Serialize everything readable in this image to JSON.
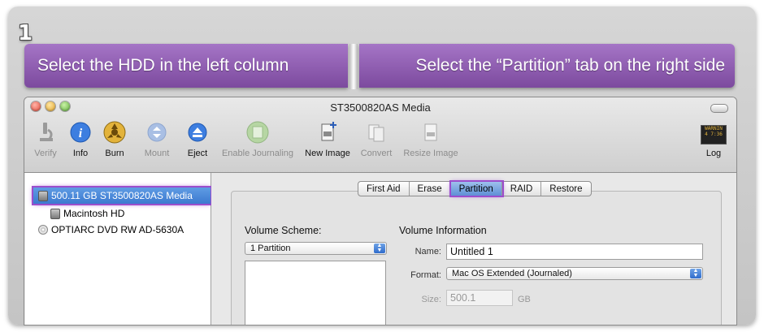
{
  "step_number": "1",
  "instructions": {
    "left": "Select the HDD in the left column",
    "right": "Select the “Partition” tab on the right side"
  },
  "window": {
    "title": "ST3500820AS Media"
  },
  "toolbar": {
    "verify": "Verify",
    "info": "Info",
    "burn": "Burn",
    "mount": "Mount",
    "eject": "Eject",
    "enable_journaling": "Enable Journaling",
    "new_image": "New Image",
    "convert": "Convert",
    "resize_image": "Resize Image",
    "log": "Log",
    "log_icon_text": "WARNIN\n4 7:36"
  },
  "sidebar": {
    "items": [
      {
        "label": "500.11 GB ST3500820AS Media",
        "selected": true
      },
      {
        "label": "Macintosh HD"
      },
      {
        "label": "OPTIARC DVD RW AD-5630A"
      }
    ]
  },
  "tabs": [
    "First Aid",
    "Erase",
    "Partition",
    "RAID",
    "Restore"
  ],
  "active_tab": "Partition",
  "partition": {
    "volume_scheme_label": "Volume Scheme:",
    "volume_scheme_value": "1 Partition",
    "volume_info_label": "Volume Information",
    "name_label": "Name:",
    "name_value": "Untitled 1",
    "format_label": "Format:",
    "format_value": "Mac OS Extended (Journaled)",
    "size_label": "Size:",
    "size_value": "500.1",
    "size_unit": "GB"
  },
  "colors": {
    "highlight": "#9c4dcc",
    "banner": "#8f5db3",
    "selection": "#3c79d0"
  }
}
